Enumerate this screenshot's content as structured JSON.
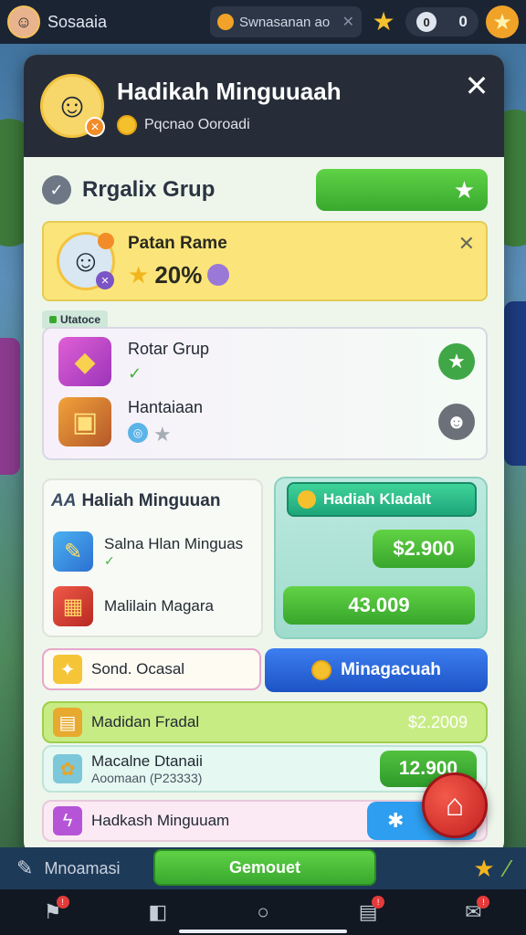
{
  "topbar": {
    "title": "Sosaaia",
    "search_text": "Swnasanan ao",
    "counter_left": "0",
    "counter_right": "0"
  },
  "modal": {
    "title": "Hadikah Minguuaah",
    "subtitle": "Pqcnao Ooroadi",
    "section_title": "Rrgalix Grup"
  },
  "profile": {
    "name": "Patan Rame",
    "percent": "20%"
  },
  "group": {
    "mini_label": "Utatoce",
    "items": [
      {
        "label": "Rotar Grup"
      },
      {
        "label": "Hantaiaan"
      }
    ]
  },
  "weekly": {
    "prefix": "AA",
    "title": "Haliah Minguuan",
    "items": [
      {
        "label": "Salna Hlan Minguas"
      },
      {
        "label": "Malilain Magara"
      }
    ]
  },
  "reward": {
    "tab_label": "Hadiah Kladalt",
    "price_1": "$2.900",
    "price_2": "43.009"
  },
  "rows": {
    "special_label": "Sond. Ocasal",
    "blue_button_label": "Minagacuah",
    "lime_label": "Madidan Fradal",
    "lime_amount": "$2.2009",
    "mint_label": "Macalne Dtanaii",
    "mint_sub": "Aoomaan (P23333)",
    "mint_price": "12.900",
    "pink_label": "Hadkash Minguuam"
  },
  "bottom": {
    "label": "Mnoamasi",
    "confirm_label": "Gemouet"
  },
  "colors": {
    "accent_green": "#38a92e",
    "accent_blue": "#1d54c5",
    "header_dark": "#262d38",
    "fab_red": "#c21f20"
  }
}
